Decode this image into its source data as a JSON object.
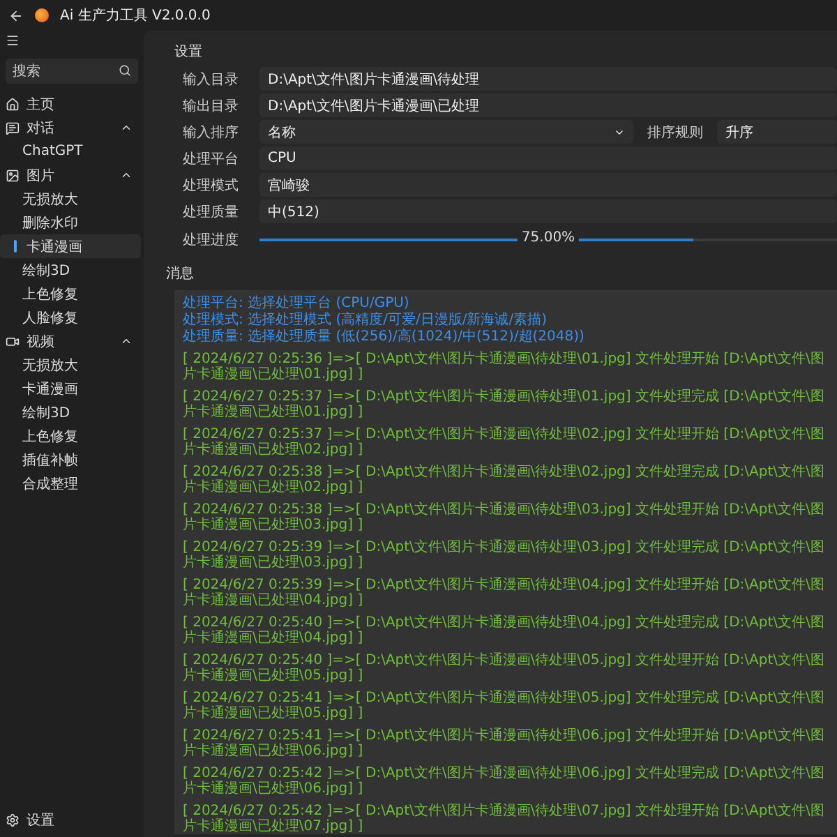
{
  "window": {
    "title": "Ai 生产力工具 V2.0.0.0"
  },
  "sidebar": {
    "search": {
      "placeholder": "搜索"
    },
    "items": [
      {
        "label": "主页",
        "kind": "home",
        "selected": false
      },
      {
        "label": "对话",
        "kind": "chat",
        "expanded": true,
        "selected": false,
        "children": [
          {
            "label": "ChatGPT",
            "selected": false
          }
        ]
      },
      {
        "label": "图片",
        "kind": "image",
        "expanded": true,
        "selected": false,
        "children": [
          {
            "label": "无损放大",
            "selected": false
          },
          {
            "label": "删除水印",
            "selected": false
          },
          {
            "label": "卡通漫画",
            "selected": true
          },
          {
            "label": "绘制3D",
            "selected": false
          },
          {
            "label": "上色修复",
            "selected": false
          },
          {
            "label": "人脸修复",
            "selected": false
          }
        ]
      },
      {
        "label": "视频",
        "kind": "video",
        "expanded": true,
        "selected": false,
        "children": [
          {
            "label": "无损放大",
            "selected": false
          },
          {
            "label": "卡通漫画",
            "selected": false
          },
          {
            "label": "绘制3D",
            "selected": false
          },
          {
            "label": "上色修复",
            "selected": false
          },
          {
            "label": "插值补帧",
            "selected": false
          },
          {
            "label": "合成整理",
            "selected": false
          }
        ]
      }
    ],
    "settings": {
      "label": "设置"
    }
  },
  "settings": {
    "title": "设置",
    "rows": [
      {
        "kind": "field",
        "label": "输入目录",
        "value": "D:\\Apt\\文件\\图片卡通漫画\\待处理"
      },
      {
        "kind": "field",
        "label": "输出目录",
        "value": "D:\\Apt\\文件\\图片卡通漫画\\已处理"
      },
      {
        "kind": "sort",
        "label": "输入排序",
        "value": "名称",
        "rule_label": "排序规则",
        "rule_value": "升序"
      },
      {
        "kind": "field",
        "label": "处理平台",
        "value": "CPU"
      },
      {
        "kind": "field",
        "label": "处理模式",
        "value": "宫崎骏"
      },
      {
        "kind": "field",
        "label": "处理质量",
        "value": "中(512)"
      },
      {
        "kind": "progress",
        "label": "处理进度",
        "level": 0.75,
        "reading": "75.00%"
      }
    ]
  },
  "messages": {
    "title": "消息",
    "lines": [
      {
        "kind": "info",
        "text": "处理平台: 选择处理平台 (CPU/GPU)"
      },
      {
        "kind": "info",
        "text": "处理模式: 选择处理模式 (高精度/可爱/日漫版/新海诚/素描)"
      },
      {
        "kind": "info",
        "text": "处理质量: 选择处理质量 (低(256)/高(1024)/中(512)/超(2048))"
      },
      {
        "kind": "log",
        "text": "[ 2024/6/27 0:25:36 ]=>[ D:\\Apt\\文件\\图片卡通漫画\\待处理\\01.jpg] 文件处理开始 [D:\\Apt\\文件\\图片卡通漫画\\已处理\\01.jpg] ]"
      },
      {
        "kind": "log",
        "text": "[ 2024/6/27 0:25:37 ]=>[ D:\\Apt\\文件\\图片卡通漫画\\待处理\\01.jpg] 文件处理完成 [D:\\Apt\\文件\\图片卡通漫画\\已处理\\01.jpg] ]"
      },
      {
        "kind": "log",
        "text": "[ 2024/6/27 0:25:37 ]=>[ D:\\Apt\\文件\\图片卡通漫画\\待处理\\02.jpg] 文件处理开始 [D:\\Apt\\文件\\图片卡通漫画\\已处理\\02.jpg] ]"
      },
      {
        "kind": "log",
        "text": "[ 2024/6/27 0:25:38 ]=>[ D:\\Apt\\文件\\图片卡通漫画\\待处理\\02.jpg] 文件处理完成 [D:\\Apt\\文件\\图片卡通漫画\\已处理\\02.jpg] ]"
      },
      {
        "kind": "log",
        "text": "[ 2024/6/27 0:25:38 ]=>[ D:\\Apt\\文件\\图片卡通漫画\\待处理\\03.jpg] 文件处理开始 [D:\\Apt\\文件\\图片卡通漫画\\已处理\\03.jpg] ]"
      },
      {
        "kind": "log",
        "text": "[ 2024/6/27 0:25:39 ]=>[ D:\\Apt\\文件\\图片卡通漫画\\待处理\\03.jpg] 文件处理完成 [D:\\Apt\\文件\\图片卡通漫画\\已处理\\03.jpg] ]"
      },
      {
        "kind": "log",
        "text": "[ 2024/6/27 0:25:39 ]=>[ D:\\Apt\\文件\\图片卡通漫画\\待处理\\04.jpg] 文件处理开始 [D:\\Apt\\文件\\图片卡通漫画\\已处理\\04.jpg] ]"
      },
      {
        "kind": "log",
        "text": "[ 2024/6/27 0:25:40 ]=>[ D:\\Apt\\文件\\图片卡通漫画\\待处理\\04.jpg] 文件处理完成 [D:\\Apt\\文件\\图片卡通漫画\\已处理\\04.jpg] ]"
      },
      {
        "kind": "log",
        "text": "[ 2024/6/27 0:25:40 ]=>[ D:\\Apt\\文件\\图片卡通漫画\\待处理\\05.jpg] 文件处理开始 [D:\\Apt\\文件\\图片卡通漫画\\已处理\\05.jpg] ]"
      },
      {
        "kind": "log",
        "text": "[ 2024/6/27 0:25:41 ]=>[ D:\\Apt\\文件\\图片卡通漫画\\待处理\\05.jpg] 文件处理完成 [D:\\Apt\\文件\\图片卡通漫画\\已处理\\05.jpg] ]"
      },
      {
        "kind": "log",
        "text": "[ 2024/6/27 0:25:41 ]=>[ D:\\Apt\\文件\\图片卡通漫画\\待处理\\06.jpg] 文件处理开始 [D:\\Apt\\文件\\图片卡通漫画\\已处理\\06.jpg] ]"
      },
      {
        "kind": "log",
        "text": "[ 2024/6/27 0:25:42 ]=>[ D:\\Apt\\文件\\图片卡通漫画\\待处理\\06.jpg] 文件处理完成 [D:\\Apt\\文件\\图片卡通漫画\\已处理\\06.jpg] ]"
      },
      {
        "kind": "log",
        "text": "[ 2024/6/27 0:25:42 ]=>[ D:\\Apt\\文件\\图片卡通漫画\\待处理\\07.jpg] 文件处理开始 [D:\\Apt\\文件\\图片卡通漫画\\已处理\\07.jpg] ]"
      }
    ]
  }
}
